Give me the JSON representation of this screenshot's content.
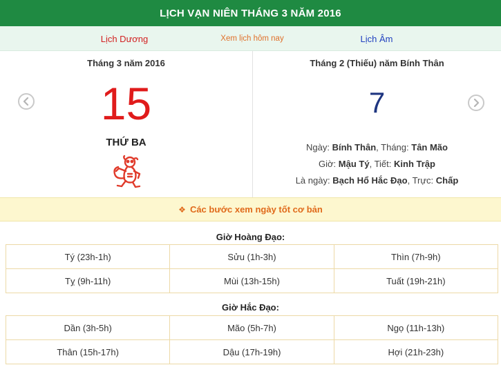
{
  "header": {
    "title": "LỊCH VẠN NIÊN THÁNG 3 NĂM 2016"
  },
  "tabs": {
    "solar": "Lịch Dương",
    "today": "Xem lịch hôm nay",
    "lunar": "Lịch Âm"
  },
  "solar": {
    "month_title": "Tháng 3 năm 2016",
    "day": "15",
    "weekday": "THỨ BA",
    "zodiac_icon": "monkey-icon"
  },
  "lunar": {
    "month_title": "Tháng 2 (Thiếu) năm Bính Thân",
    "day": "7",
    "day_label": "Ngày:",
    "day_value": "Bính Thân",
    "month_label": ", Tháng:",
    "month_value": "Tân Mão",
    "hour_label": "Giờ:",
    "hour_value": "Mậu Tý",
    "term_label": ", Tiết:",
    "term_value": "Kinh Trập",
    "dayis_label": "Là ngày:",
    "dayis_value": "Bạch Hổ Hắc Đạo",
    "truc_label": ", Trực:",
    "truc_value": "Chấp"
  },
  "guide": {
    "icon": "diamond-icon",
    "label": "Các bước xem ngày tốt cơ bản"
  },
  "good_hours": {
    "title": "Giờ Hoàng Đạo:",
    "rows": [
      [
        "Tý (23h-1h)",
        "Sửu (1h-3h)",
        "Thìn (7h-9h)"
      ],
      [
        "Tỵ (9h-11h)",
        "Mùi (13h-15h)",
        "Tuất (19h-21h)"
      ]
    ]
  },
  "bad_hours": {
    "title": "Giờ Hắc Đạo:",
    "rows": [
      [
        "Dần (3h-5h)",
        "Mão (5h-7h)",
        "Ngọ (11h-13h)"
      ],
      [
        "Thân (15h-17h)",
        "Dậu (17h-19h)",
        "Hợi (21h-23h)"
      ]
    ]
  },
  "colors": {
    "header_bg": "#1f8a42",
    "solar_red": "#e01b1b",
    "lunar_blue": "#1e3580",
    "guide_orange": "#e06a1b"
  }
}
